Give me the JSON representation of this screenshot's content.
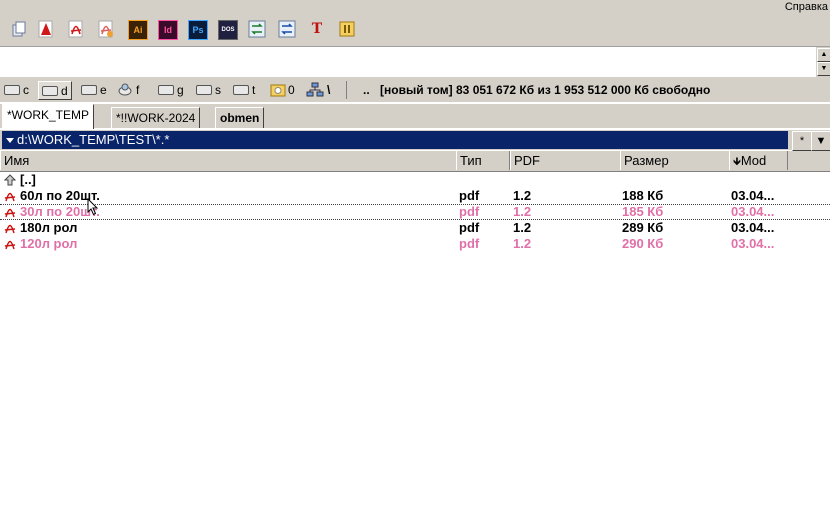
{
  "menubar": {
    "help": "Справка"
  },
  "toolbar": {
    "icons": [
      "copy-files-icon",
      "acrobat-icon",
      "pdf-icon",
      "pdf-alt-icon",
      "illustrator-icon",
      "indesign-icon",
      "photoshop-icon",
      "dos-console-icon",
      "sync-icon",
      "compare-icon",
      "text-tool-icon",
      "archive-icon"
    ],
    "labels": {
      "ai": "Ai",
      "id": "Id",
      "ps": "Ps",
      "dos": "DOS",
      "tt": "T"
    }
  },
  "drives": [
    {
      "letter": "c",
      "active": false
    },
    {
      "letter": "d",
      "active": true
    },
    {
      "letter": "e",
      "active": false
    },
    {
      "letter": "f",
      "active": false
    },
    {
      "letter": "g",
      "active": false
    },
    {
      "letter": "s",
      "active": false
    },
    {
      "letter": "t",
      "active": false
    },
    {
      "letter": "0",
      "active": false
    }
  ],
  "drive_extras": {
    "root": "\\",
    "up": ".."
  },
  "volume": {
    "info": "[новый том]  83   051   672 Кб из 1   953   512   000 Кб свободно"
  },
  "tabs": [
    {
      "label": "*WORK_TEMP",
      "active": true
    },
    {
      "label": "*!!WORK-2024",
      "active": false
    },
    {
      "label": "obmen",
      "active": false
    }
  ],
  "path": {
    "current": "d:\\WORK_TEMP\\TEST\\*.*",
    "star": "*"
  },
  "columns": {
    "name": "Имя",
    "type": "Тип",
    "pdf": "PDF",
    "size": "Размер",
    "mod": "Mod",
    "mod_sort_arrow": "🡻"
  },
  "files": [
    {
      "name": "[..]",
      "type": "",
      "pdf": "",
      "size": "",
      "mod": "",
      "selected": false,
      "focused": false,
      "kind": "up"
    },
    {
      "name": "60л по 20шт.",
      "type": "pdf",
      "pdf": "1.2",
      "size": "188 Кб",
      "mod": "03.04...",
      "selected": false,
      "focused": false,
      "kind": "pdf"
    },
    {
      "name": "30л по 20шт.",
      "type": "pdf",
      "pdf": "1.2",
      "size": "185 Кб",
      "mod": "03.04...",
      "selected": true,
      "focused": true,
      "kind": "pdf"
    },
    {
      "name": "180л рол",
      "type": "pdf",
      "pdf": "1.2",
      "size": "289 Кб",
      "mod": "03.04...",
      "selected": false,
      "focused": false,
      "kind": "pdf"
    },
    {
      "name": "120л рол",
      "type": "pdf",
      "pdf": "1.2",
      "size": "290 Кб",
      "mod": "03.04...",
      "selected": true,
      "focused": false,
      "kind": "pdf"
    }
  ],
  "colors": {
    "path_bg": "#0a246a",
    "selected_text": "#e070a8",
    "chrome": "#d4d0c8",
    "pdf_red": "#cc1111"
  }
}
